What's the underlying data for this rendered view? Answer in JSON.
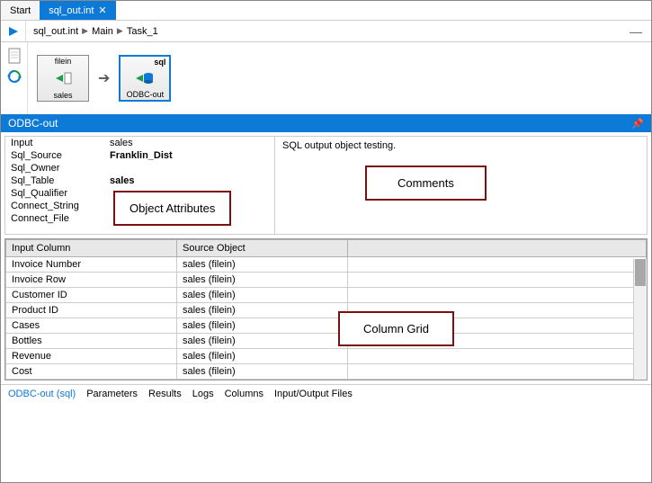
{
  "tabs": {
    "start": "Start",
    "active": "sql_out.int"
  },
  "breadcrumb": {
    "file": "sql_out.int",
    "main": "Main",
    "task": "Task_1"
  },
  "nodes": {
    "n1": {
      "top": "filein",
      "bottom": "sales"
    },
    "n2": {
      "top": "sql",
      "bottom": "ODBC-out"
    }
  },
  "panel": {
    "title": "ODBC-out"
  },
  "attributes": [
    {
      "k": "Input",
      "v": "sales",
      "bold": false
    },
    {
      "k": "Sql_Source",
      "v": "Franklin_Dist",
      "bold": true
    },
    {
      "k": "Sql_Owner",
      "v": "",
      "bold": false
    },
    {
      "k": "Sql_Table",
      "v": "sales",
      "bold": true
    },
    {
      "k": "Sql_Qualifier",
      "v": "",
      "bold": false
    },
    {
      "k": "Connect_String",
      "v": "",
      "bold": false
    },
    {
      "k": "Connect_File",
      "v": "",
      "bold": false
    }
  ],
  "comments_text": "SQL output object testing.",
  "callouts": {
    "attrs": "Object Attributes",
    "comments": "Comments",
    "grid": "Column Grid"
  },
  "grid": {
    "headers": {
      "c1": "Input Column",
      "c2": "Source Object"
    },
    "rows": [
      {
        "c1": "Invoice Number",
        "c2": "sales (filein)"
      },
      {
        "c1": "Invoice Row",
        "c2": "sales (filein)"
      },
      {
        "c1": "Customer ID",
        "c2": "sales (filein)"
      },
      {
        "c1": "Product ID",
        "c2": "sales (filein)"
      },
      {
        "c1": "Cases",
        "c2": "sales (filein)"
      },
      {
        "c1": "Bottles",
        "c2": "sales (filein)"
      },
      {
        "c1": "Revenue",
        "c2": "sales (filein)"
      },
      {
        "c1": "Cost",
        "c2": "sales (filein)"
      }
    ]
  },
  "bottom_tabs": {
    "t1": "ODBC-out (sql)",
    "t2": "Parameters",
    "t3": "Results",
    "t4": "Logs",
    "t5": "Columns",
    "t6": "Input/Output Files"
  }
}
